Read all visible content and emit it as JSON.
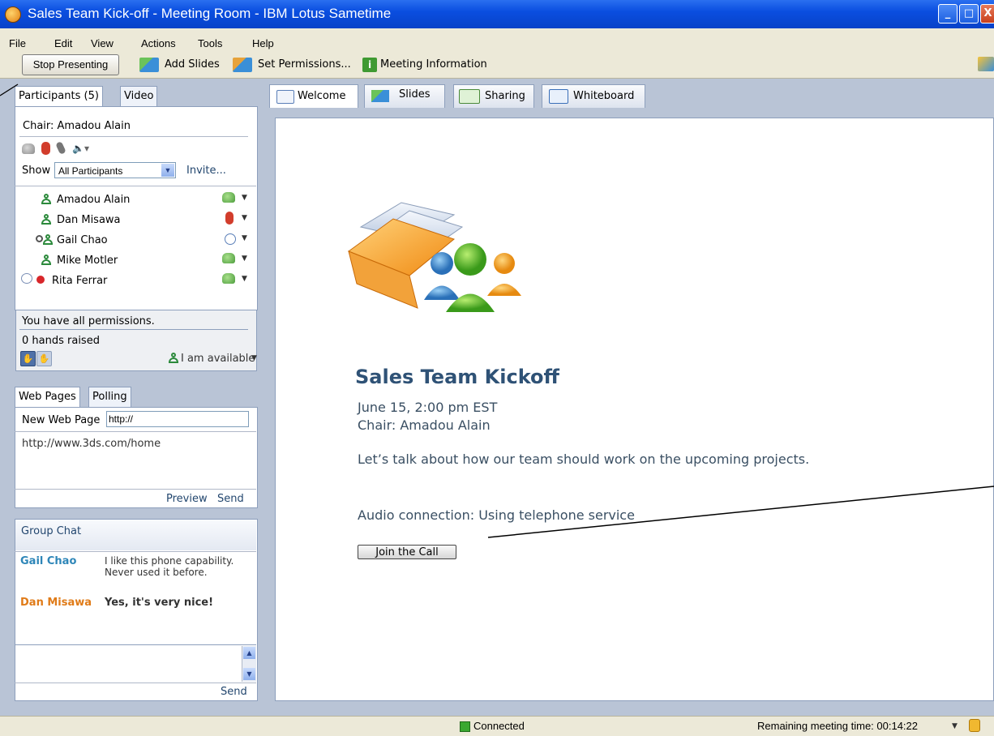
{
  "window": {
    "title": "Sales Team Kick-off - Meeting Room - IBM Lotus Sametime"
  },
  "menu": [
    "File",
    "Edit",
    "View",
    "Actions",
    "Tools",
    "Help"
  ],
  "toolbar": {
    "stop_presenting": "Stop Presenting",
    "add_slides": "Add Slides",
    "set_permissions": "Set Permissions...",
    "meeting_information": "Meeting Information"
  },
  "participants_panel": {
    "tabs": [
      "Participants (5)",
      "Video"
    ],
    "chair": "Chair: Amadou Alain",
    "show_label": "Show",
    "filter": "All Participants",
    "invite": "Invite...",
    "list": [
      {
        "name": "Amadou Alain",
        "status_icon": "phone-icon"
      },
      {
        "name": "Dan Misawa",
        "status_icon": "mute-icon"
      },
      {
        "name": "Gail Chao",
        "status_icon": "clock-icon"
      },
      {
        "name": "Mike Motler",
        "status_icon": "phone-icon"
      },
      {
        "name": "Rita Ferrar",
        "status_icon": "phone-icon"
      }
    ],
    "permissions": "You have all permissions.",
    "hands": "0 hands raised",
    "availability": "I am available"
  },
  "web_panel": {
    "tabs": [
      "Web Pages",
      "Polling"
    ],
    "new_label": "New Web Page",
    "url_value": "http://",
    "pages": [
      "http://www.3ds.com/home"
    ],
    "preview": "Preview",
    "send": "Send"
  },
  "chat": {
    "title": "Group Chat",
    "messages": [
      {
        "sender": "Gail Chao",
        "text": "I like this phone capability. Never used it before.",
        "color": "#2e86b8"
      },
      {
        "sender": "Dan Misawa",
        "text": "Yes, it's very nice!",
        "color": "#e07b18"
      }
    ],
    "send": "Send"
  },
  "main_tabs": [
    "Welcome",
    "Slides",
    "Sharing",
    "Whiteboard"
  ],
  "welcome": {
    "title": "Sales Team Kickoff",
    "date": "June 15, 2:00 pm EST",
    "chair": "Chair: Amadou Alain",
    "description": "Let’s talk about how our team should work on the upcoming projects.",
    "audio": "Audio connection: Using telephone service",
    "join_button": "Join the Call",
    "title_color": "#2f5276",
    "text_color": "#3a4f63"
  },
  "status": {
    "connection": "Connected",
    "remaining": "Remaining meeting time: 00:14:22"
  }
}
